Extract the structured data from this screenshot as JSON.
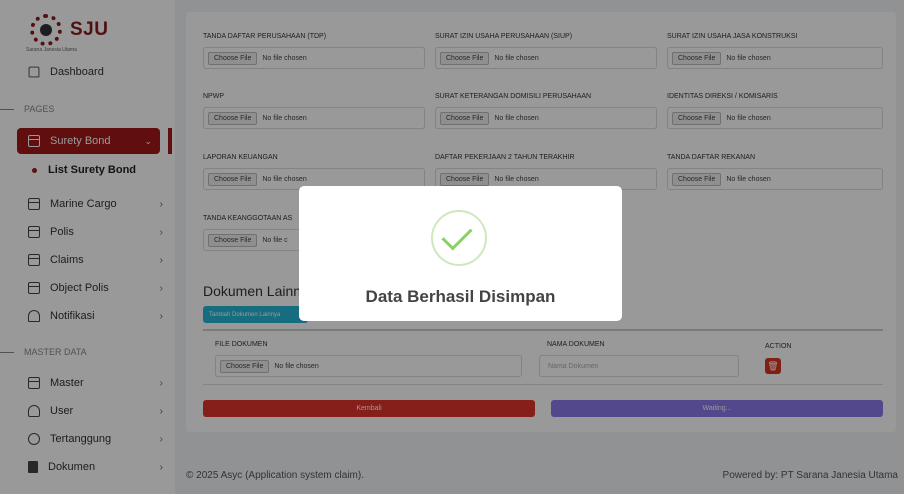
{
  "brand": {
    "name": "SJU",
    "tagline": "Sarana Janesia Utama"
  },
  "sidebar": {
    "dashboard": "Dashboard",
    "section_pages": "PAGES",
    "surety_bond": "Surety Bond",
    "list_surety_bond": "List Surety Bond",
    "marine_cargo": "Marine Cargo",
    "polis": "Polis",
    "claims": "Claims",
    "object_polis": "Object Polis",
    "notifikasi": "Notifikasi",
    "section_master": "MASTER DATA",
    "master": "Master",
    "user": "User",
    "tertanggung": "Tertanggung",
    "dokumen": "Dokumen"
  },
  "form": {
    "choose_file": "Choose File",
    "no_file": "No file chosen",
    "fields": [
      {
        "label": "TANDA DAFTAR PERUSAHAAN (TDP)"
      },
      {
        "label": "SURAT IZIN USAHA PERUSAHAAN (SIUP)"
      },
      {
        "label": "SURAT IZIN USAHA JASA KONSTRUKSI"
      },
      {
        "label": "NPWP"
      },
      {
        "label": "SURAT KETERANGAN DOMISILI PERUSAHAAN"
      },
      {
        "label": "IDENTITAS DIREKSI / KOMISARIS"
      },
      {
        "label": "LAPORAN KEUANGAN"
      },
      {
        "label": "DAFTAR PEKERJAAN 2 TAHUN TERAKHIR"
      },
      {
        "label": "TANDA DAFTAR REKANAN"
      },
      {
        "label": "TANDA KEANGGOTAAN AS"
      }
    ],
    "no_file_partial": "No file c"
  },
  "dokumen_lainnya": {
    "title": "Dokumen Lainnya",
    "add_button": "Tambah Dokumen Lainnya",
    "col_file": "FILE DOKUMEN",
    "col_name": "NAMA DOKUMEN",
    "col_action": "ACTION",
    "name_placeholder": "Nama Dokumen"
  },
  "actions": {
    "back": "Kembali",
    "waiting": "Waiting..."
  },
  "footer": {
    "left": "© 2025 Asyc (Application system claim).",
    "right": "Powered by: PT Sarana Janesia Utama"
  },
  "modal": {
    "message": "Data Berhasil Disimpan"
  },
  "colors": {
    "brand": "#a01818",
    "success": "#8ccf68",
    "danger": "#e0342a",
    "info": "#26b6d4",
    "primary": "#8978e8"
  }
}
